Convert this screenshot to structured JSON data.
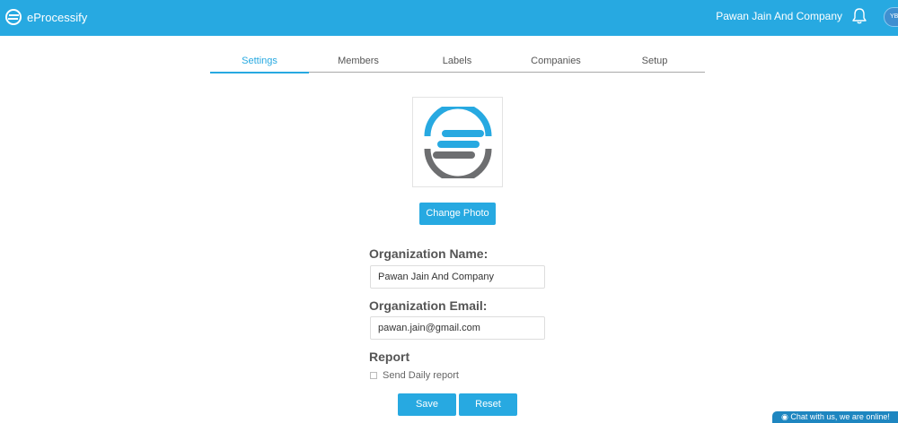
{
  "header": {
    "brand_name": "eProcessify",
    "organization": "Pawan Jain And Company",
    "avatar_initials": "YB",
    "bg_color": "#27a9e1"
  },
  "tabs": [
    {
      "label": "Settings",
      "active": true
    },
    {
      "label": "Members",
      "active": false
    },
    {
      "label": "Labels",
      "active": false
    },
    {
      "label": "Companies",
      "active": false
    },
    {
      "label": "Setup",
      "active": false
    }
  ],
  "photo": {
    "change_label": "Change Photo",
    "logo_colors": {
      "primary": "#27a9e1",
      "secondary": "#6d6e70"
    }
  },
  "form": {
    "org_name_label": "Organization Name:",
    "org_name_value": "Pawan Jain And Company",
    "org_email_label": "Organization Email:",
    "org_email_value": "pawan.jain@gmail.com",
    "report_label": "Report",
    "daily_report_label": "Send Daily report",
    "daily_report_checked": false,
    "save_label": "Save",
    "reset_label": "Reset"
  },
  "chat": {
    "text": "Chat with us, we are online!"
  }
}
